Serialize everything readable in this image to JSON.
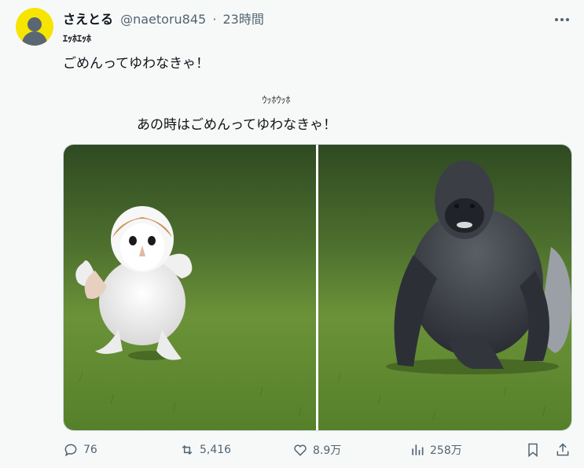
{
  "tweet": {
    "display_name": "さえとる",
    "handle": "@naetoru845",
    "separator": "·",
    "time": "23時間",
    "subtitle": "ｴｯﾎｴｯﾎ",
    "text": "ごめんってゆわなきゃ！"
  },
  "meme": {
    "top_text": "ｳｯﾎｳｯﾎ",
    "caption": "あの時はごめんってゆわなきゃ！",
    "left_subject": "owl-chick",
    "right_subject": "gorilla"
  },
  "actions": {
    "replies": "76",
    "reposts": "5,416",
    "likes": "8.9万",
    "views": "258万"
  },
  "icons": [
    "more-icon",
    "reply-icon",
    "repost-icon",
    "like-icon",
    "views-icon",
    "bookmark-icon",
    "share-icon"
  ],
  "colors": {
    "avatar_bg": "#f5e500",
    "text_secondary": "#536471",
    "grass": "#5f8a2e"
  }
}
